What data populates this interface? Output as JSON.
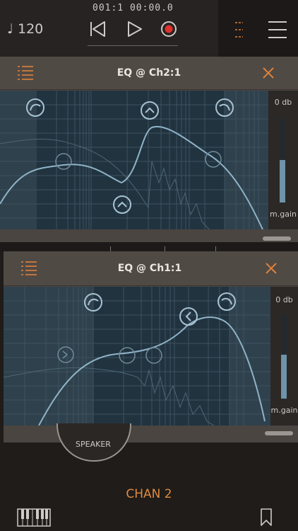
{
  "transport": {
    "tempo": "♩ 120",
    "position": "001:1   00:00.0"
  },
  "colors": {
    "accent": "#e0823a",
    "curve": "#8fb3c8",
    "graph_bg": "#21333f",
    "panel_bg": "#4a4541"
  },
  "panels": [
    {
      "title": "EQ @ Ch2:1",
      "db_label": "0 db",
      "gain_label": "m.gain",
      "meter_level": 0.35
    },
    {
      "title": "EQ @ Ch1:1",
      "db_label": "0 db",
      "gain_label": "m.gain",
      "meter_level": 0.42
    }
  ],
  "bottom": {
    "speaker_label": "SPEAKER",
    "channel_label": "CHAN 2"
  },
  "icons": [
    "note-icon",
    "skip-back-icon",
    "play-icon",
    "record-icon",
    "tracks-icon",
    "hamburger-menu-icon",
    "list-icon",
    "close-icon",
    "band-handle-icon",
    "keyboard-icon",
    "bookmark-icon"
  ]
}
